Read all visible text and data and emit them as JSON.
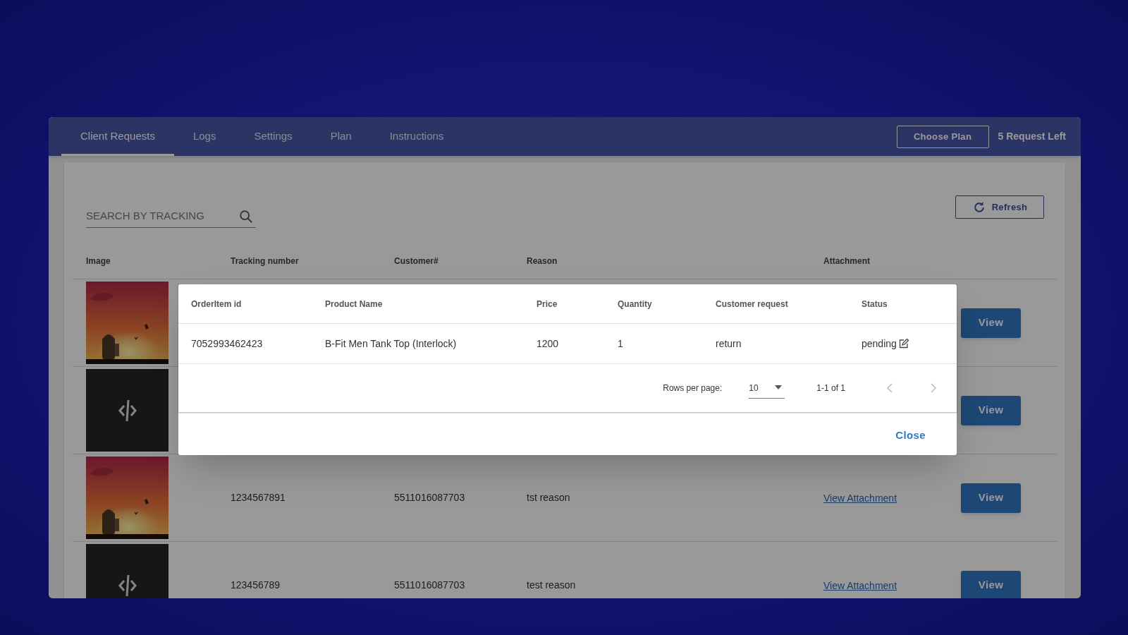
{
  "nav": {
    "tabs": [
      {
        "label": "Client Requests",
        "selected": true
      },
      {
        "label": "Logs",
        "selected": false
      },
      {
        "label": "Settings",
        "selected": false
      },
      {
        "label": "Plan",
        "selected": false
      },
      {
        "label": "Instructions",
        "selected": false
      }
    ],
    "choose_plan_button": "Choose Plan",
    "requests_left": "5 Request Left"
  },
  "search": {
    "placeholder": "SEARCH BY TRACKING"
  },
  "refresh_button": "Refresh",
  "table": {
    "columns": [
      "Image",
      "Tracking number",
      "Customer#",
      "Reason",
      "Attachment"
    ],
    "rows": [
      {
        "view_button": "View"
      },
      {
        "image": {
          "kind": "code"
        },
        "view_button": "View"
      },
      {
        "tracking_number": "1234567891",
        "customer": "5511016087703",
        "reason": "tst reason",
        "attachment": "View Attachment",
        "view_button": "View"
      },
      {
        "image": {
          "kind": "code"
        },
        "tracking_number": "123456789",
        "customer": "5511016087703",
        "reason": "test reason",
        "attachment": "View Attachment",
        "view_button": "View"
      }
    ]
  },
  "dialog": {
    "columns": [
      "OrderItem id",
      "Product Name",
      "Price",
      "Quantity",
      "Customer request",
      "Status"
    ],
    "rows": [
      {
        "orderitem_id": "7052993462423",
        "product_name": "B-Fit Men Tank Top (Interlock)",
        "price": "1200",
        "quantity": "1",
        "customer_request": "return",
        "status": "pending"
      }
    ],
    "pagination": {
      "rows_per_page_label": "Rows per page:",
      "rows_per_page": "10",
      "range": "1-1 of 1"
    },
    "close_button": "Close"
  }
}
